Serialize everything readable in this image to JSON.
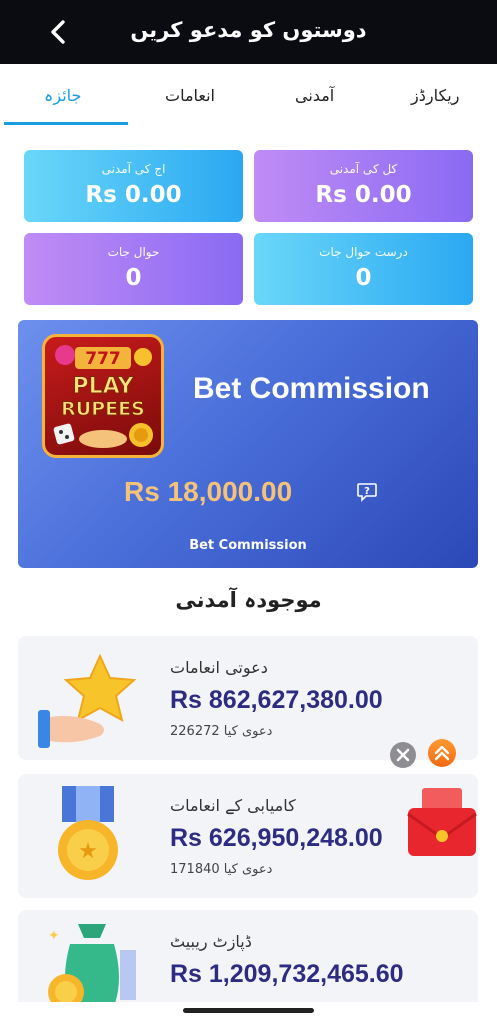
{
  "header": {
    "title": "دوستوں کو مدعو کریں"
  },
  "tabs": [
    {
      "label": "ریکارڈز"
    },
    {
      "label": "آمدنی"
    },
    {
      "label": "انعامات"
    },
    {
      "label": "جائزہ",
      "active": true
    }
  ],
  "stats": [
    {
      "label": "کل کی آمدنی",
      "value": "Rs 0.00"
    },
    {
      "label": "اج کی آمدنی",
      "value": "Rs 0.00"
    },
    {
      "label": "درست حوال جات",
      "value": "0"
    },
    {
      "label": "حوال جات",
      "value": "0"
    }
  ],
  "banner": {
    "logo_line1": "PLAY",
    "logo_line2": "RUPEES",
    "logo_top": "777",
    "title": "Bet Commission",
    "amount": "Rs 18,000.00",
    "caption": "Bet Commission"
  },
  "section": {
    "title": "موجودہ آمدنی"
  },
  "cards": [
    {
      "label": "دعوتی انعامات",
      "amount": "Rs 862,627,380.00",
      "claimed": "دعوی کیا 226272",
      "icon": "star-hand-icon"
    },
    {
      "label": "کامیابی کے انعامات",
      "amount": "Rs 626,950,248.00",
      "claimed": "دعوی کیا 171840",
      "icon": "medal-icon"
    },
    {
      "label": "ڈپازٹ ریبیٹ",
      "amount": "Rs 1,209,732,465.60",
      "claimed": "",
      "icon": "money-bag-icon"
    }
  ],
  "colors": {
    "accent": "#1a9de0",
    "amount": "#2d2c82",
    "banner_amount": "#f5c27a",
    "header_bg": "#0b0b12"
  }
}
